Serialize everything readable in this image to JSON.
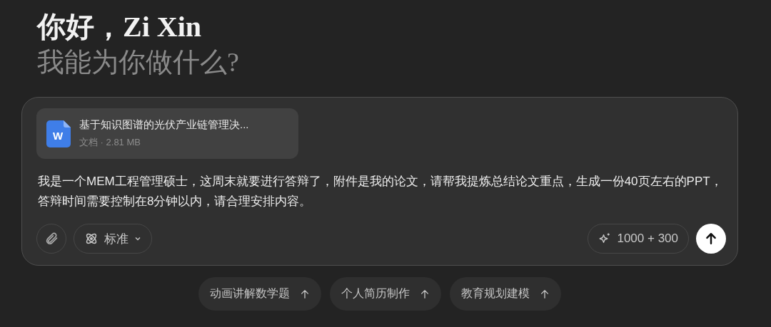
{
  "greeting": {
    "title": "你好，Zi Xin",
    "subtitle": "我能为你做什么?"
  },
  "composer": {
    "attachment": {
      "name": "基于知识图谱的光伏产业链管理决...",
      "meta": "文档 · 2.81 MB",
      "badge": "W"
    },
    "message": "我是一个MEM工程管理硕士，这周末就要进行答辩了，附件是我的论文，请帮我提炼总结论文重点，生成一份40页左右的PPT，答辩时间需要控制在8分钟以内，请合理安排内容。",
    "mode": "标准",
    "quota": "1000 + 300"
  },
  "suggestions": [
    {
      "label": "动画讲解数学题"
    },
    {
      "label": "个人简历制作"
    },
    {
      "label": "教育规划建模"
    }
  ]
}
